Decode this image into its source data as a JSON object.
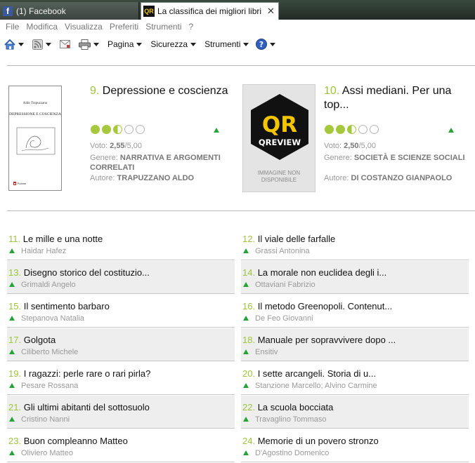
{
  "browser": {
    "tabs": [
      {
        "icon": "facebook-icon",
        "icon_glyph": "f",
        "title": "(1) Facebook",
        "active": false
      },
      {
        "icon": "qr-review-icon",
        "icon_glyph": "QR",
        "title": "La classifica dei migliori libri",
        "active": true,
        "close": "✕"
      }
    ],
    "menu": [
      "File",
      "Modifica",
      "Visualizza",
      "Preferiti",
      "Strumenti",
      "?"
    ],
    "commands": {
      "page": "Pagina",
      "safety": "Sicurezza",
      "tools": "Strumenti"
    }
  },
  "featured": [
    {
      "rank": "9.",
      "title": "Depressione e coscienza",
      "rating_label": "Voto: ",
      "rating": "2,55",
      "rating_max": "/5,00",
      "rating_value": 2.55,
      "genre_label": "Genere: ",
      "genre": "NARRATIVA E ARGOMENTI CORRELATI",
      "author_label": "Autore: ",
      "author": "TRAPUZZANO ALDO",
      "cover": {
        "author": "Aldo Trapuzzano",
        "title": "DEPRESSIONE E COSCIENZA",
        "publisher": "Pubme"
      }
    },
    {
      "rank": "10.",
      "title": "Assi mediani. Per una top...",
      "rating_label": "Voto: ",
      "rating": "2,50",
      "rating_max": "/5,00",
      "rating_value": 2.5,
      "genre_label": "Genere: ",
      "genre": "SOCIETÀ E SCIENZE SOCIALI",
      "author_label": "Autore: ",
      "author": "DI COSTANZO GIANPAOLO",
      "cover": {
        "logo_top": "QR",
        "logo_bottom": "QREVIEW",
        "placeholder": "IMMAGINE NON DISPONIBILE"
      }
    }
  ],
  "list": [
    {
      "rank": "11.",
      "title": "Le mille e una notte",
      "author": "Haidar Hafez"
    },
    {
      "rank": "12.",
      "title": "Il viale delle farfalle",
      "author": "Grassi Antonina"
    },
    {
      "rank": "13.",
      "title": "Disegno storico del costituzio...",
      "author": "Grimaldi Angelo"
    },
    {
      "rank": "14.",
      "title": "La morale non euclidea degli i...",
      "author": "Ottaviani Fabrizio"
    },
    {
      "rank": "15.",
      "title": "Il sentimento barbaro",
      "author": "Stepanova Natalia"
    },
    {
      "rank": "16.",
      "title": "Il metodo Greenopoli. Contenut...",
      "author": "De Feo Giovanni"
    },
    {
      "rank": "17.",
      "title": "Golgota",
      "author": "Ciliberto Michele"
    },
    {
      "rank": "18.",
      "title": "Manuale per sopravvivere dopo ...",
      "author": "Ensitiv"
    },
    {
      "rank": "19.",
      "title": "I ragazzi: perle rare o rari pirla?",
      "author": "Pesare Rossana"
    },
    {
      "rank": "20.",
      "title": "I sette arcangeli. Storia di u...",
      "author": "Stanzione Marcello; Alvino Carmine"
    },
    {
      "rank": "21.",
      "title": "Gli ultimi abitanti del sottosuolo",
      "author": "Cristino Nanni"
    },
    {
      "rank": "22.",
      "title": "La scuola bocciata",
      "author": "Travaglino Tommaso"
    },
    {
      "rank": "23.",
      "title": "Buon compleanno Matteo",
      "author": "Oliviero Matteo"
    },
    {
      "rank": "24.",
      "title": "Memorie di un povero stronzo",
      "author": "D'Agostino Domenico"
    }
  ]
}
